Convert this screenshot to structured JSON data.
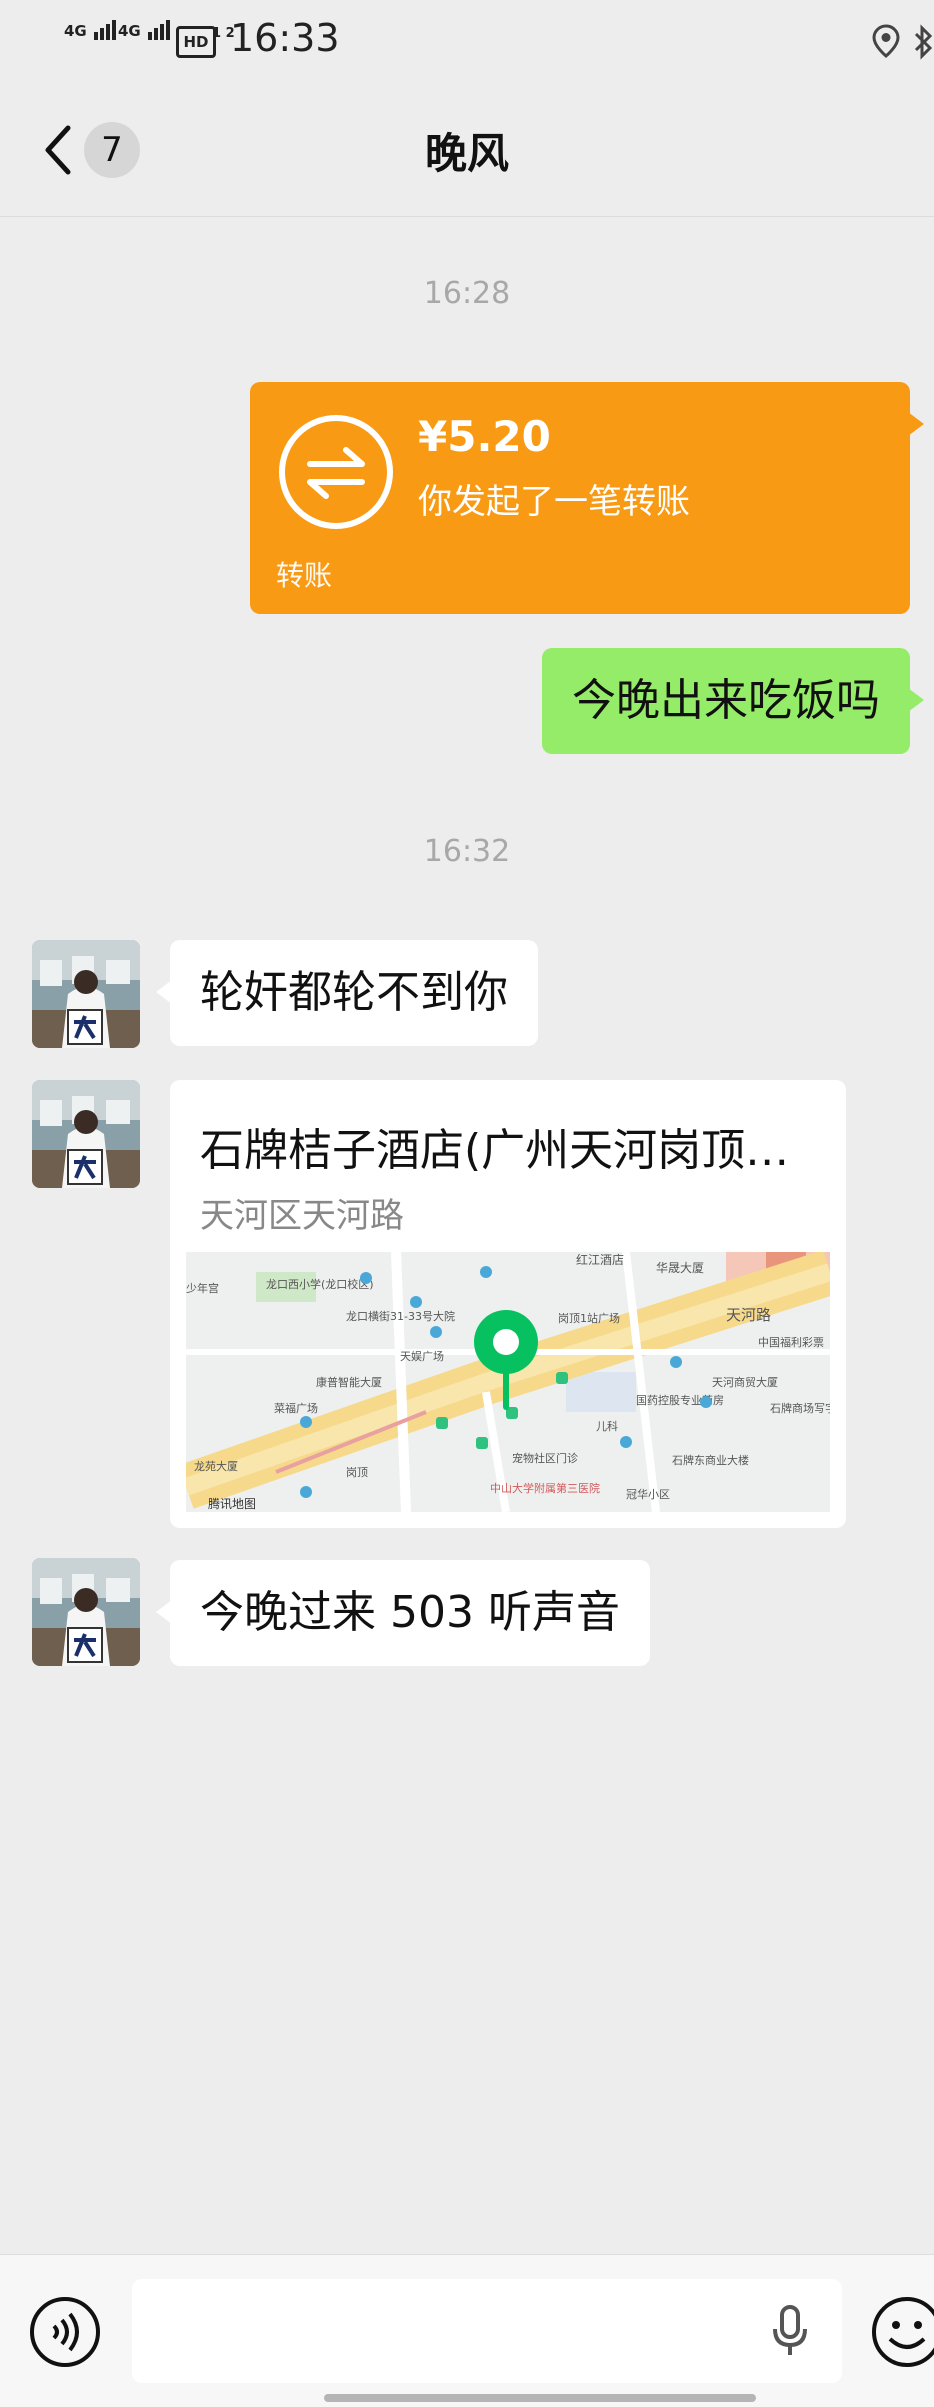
{
  "status_bar": {
    "signal_1": "4G",
    "signal_2": "4G",
    "hd_label": "HD",
    "hd_sub": "1 2",
    "time": "16:33",
    "icons": [
      "location-icon",
      "bluetooth-icon"
    ]
  },
  "nav": {
    "back_icon": "chevron-left-icon",
    "unread_count": "7",
    "title": "晚风"
  },
  "messages": {
    "timestamp_1": "16:28",
    "transfer": {
      "amount": "¥5.20",
      "description": "你发起了一笔转账",
      "label": "转账",
      "color": "#f99a15"
    },
    "sent_text": "今晚出来吃饭吗",
    "timestamp_2": "16:32",
    "received_1": "轮奸都轮不到你",
    "location": {
      "name": "石牌桔子酒店(广州天河岗顶…",
      "address": "天河区天河路",
      "map_labels": {
        "road": "天河路",
        "hotel": "红江酒店",
        "huasheng": "华晟大厦",
        "gangding_square": "岗顶1站广场",
        "longkou_school": "龙口西小学(龙口校区)",
        "longkou_street": "龙口横街31-33号大院",
        "tianyu": "天娱广场",
        "kangnai": "康普智能大厦",
        "caifu": "菜福广场",
        "longyuan": "龙苑大厦",
        "gangding": "岗顶",
        "tianhe_commercial": "天河商贸大厦",
        "guoyao": "国药控股专业药房",
        "erke": "儿科",
        "shipai_east": "石牌东商业大楼",
        "guanhua": "冠华小区",
        "zhongshan": "中山大学附属第三医院",
        "pet": "宠物社区门诊",
        "welfare": "中国福利彩票",
        "shipai_office": "石牌商场写字楼",
        "shaonian": "少年宫",
        "tencent": "腾讯地图"
      }
    },
    "received_2": "今晚过来 503 听声音"
  },
  "colors": {
    "chat_bg": "#ededed",
    "sent_bubble": "#95ec69",
    "received_bubble": "#ffffff",
    "pin_green": "#07c160"
  },
  "input_bar": {
    "voice_icon": "voice-mode-icon",
    "mic_icon": "microphone-icon",
    "emoji_icon": "emoji-icon",
    "value": ""
  }
}
